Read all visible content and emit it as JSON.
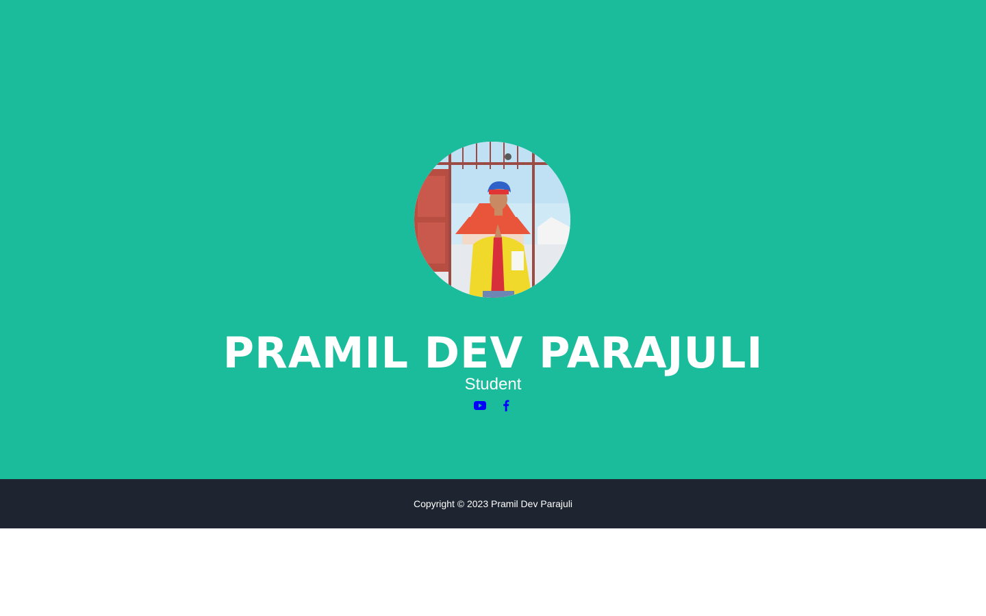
{
  "profile": {
    "name": "PRAMIL DEV PARAJULI",
    "role": "Student",
    "photo_alt": "Pramil Dev Parajuli"
  },
  "social": {
    "items": [
      {
        "icon": "youtube-icon",
        "color": "#0000ff"
      },
      {
        "icon": "facebook-icon",
        "color": "#0000ff"
      }
    ]
  },
  "footer": {
    "copyright": "Copyright © 2023 Pramil Dev Parajuli"
  },
  "colors": {
    "hero_background": "#1abc9c",
    "footer_background": "#1e2530",
    "text": "#ffffff",
    "link": "#0000ff"
  }
}
